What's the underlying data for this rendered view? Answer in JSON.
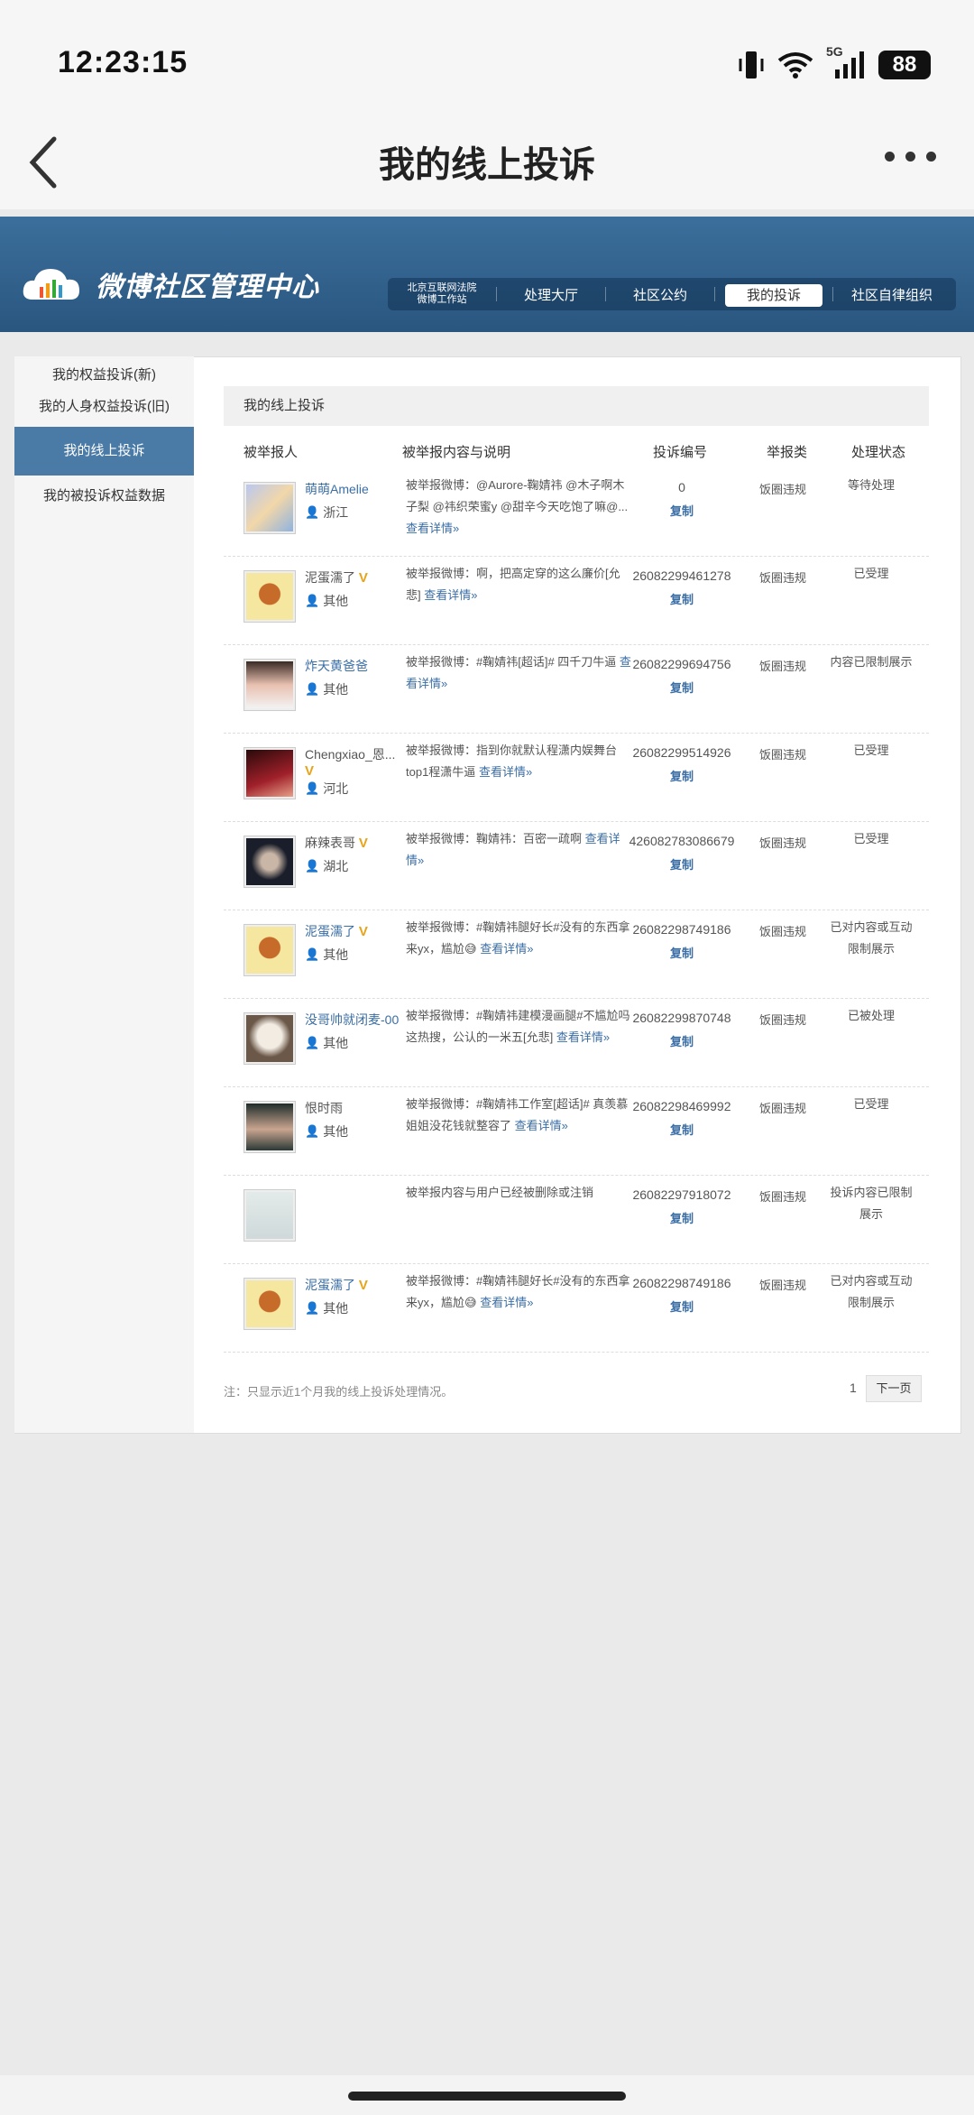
{
  "status_bar": {
    "time": "12:23:15",
    "network": "5G",
    "battery": "88"
  },
  "header": {
    "title": "我的线上投诉"
  },
  "banner": {
    "logo_text": "微博社区管理中心",
    "nav": [
      {
        "label": "北京互联网法院\n微博工作站"
      },
      {
        "label": "处理大厅"
      },
      {
        "label": "社区公约"
      },
      {
        "label": "我的投诉"
      },
      {
        "label": "社区自律组织"
      }
    ]
  },
  "sidebar": {
    "items": [
      {
        "label": "我的权益投诉(新)"
      },
      {
        "label": "我的人身权益投诉(旧)"
      },
      {
        "label": "我的线上投诉"
      },
      {
        "label": "我的被投诉权益数据"
      }
    ]
  },
  "panel": {
    "title": "我的线上投诉",
    "columns": [
      "被举报人",
      "被举报内容与说明",
      "投诉编号",
      "举报类",
      "处理状态"
    ],
    "copy_label": "复制",
    "rows": [
      {
        "name": "萌萌Amelie",
        "location": "浙江",
        "content": "被举报微博：@Aurore-鞠婧祎 @木子啊木子梨 @祎织荣蜜y @甜辛今天吃饱了嘛@...",
        "more": "查看详情»",
        "id": "0",
        "category": "饭圈违规",
        "status": "等待处理"
      },
      {
        "name": "泥蛋濡了",
        "location": "其他",
        "content": "被举报微博：啊，把高定穿的这么廉价[允悲]",
        "more": "查看详情»",
        "id": "26082299461278",
        "category": "饭圈违规",
        "status": "已受理"
      },
      {
        "name": "炸天黄爸爸",
        "location": "其他",
        "content": "被举报微博：#鞠婧祎[超话]# 四千刀牛逼",
        "more": "查看详情»",
        "id": "26082299694756",
        "category": "饭圈违规",
        "status": "内容已限制展示"
      },
      {
        "name": "Chengxiao_恩...",
        "location": "河北",
        "content": "被举报微博：指到你就默认程潇内娱舞台top1程潇牛逼",
        "more": "查看详情»",
        "id": "26082299514926",
        "category": "饭圈违规",
        "status": "已受理"
      },
      {
        "name": "麻辣表哥",
        "location": "湖北",
        "content": "被举报微博：鞠婧祎：百密一疏啊",
        "more": "查看详情»",
        "id": "426082783086679",
        "category": "饭圈违规",
        "status": "已受理"
      },
      {
        "name": "泥蛋濡了",
        "location": "其他",
        "content": "被举报微博：#鞠婧祎腿好长#没有的东西拿来yx，尴尬😅",
        "more": "查看详情»",
        "id": "26082298749186",
        "category": "饭圈违规",
        "status": "已对内容或互动限制展示"
      },
      {
        "name": "没哥帅就闭麦-00",
        "location": "其他",
        "content": "被举报微博：#鞠婧祎建模漫画腿#不尴尬吗这热搜，公认的一米五[允悲]",
        "more": "查看详情»",
        "id": "26082299870748",
        "category": "饭圈违规",
        "status": "已被处理"
      },
      {
        "name": "恨时雨",
        "location": "其他",
        "content": "被举报微博：#鞠婧祎工作室[超话]# 真羡慕姐姐没花钱就整容了",
        "more": "查看详情»",
        "id": "26082298469992",
        "category": "饭圈违规",
        "status": "已受理"
      },
      {
        "name": "",
        "location": "",
        "content": "被举报内容与用户已经被删除或注销",
        "more": "",
        "id": "26082297918072",
        "category": "饭圈违规",
        "status": "投诉内容已限制展示"
      },
      {
        "name": "泥蛋濡了",
        "location": "其他",
        "content": "被举报微博：#鞠婧祎腿好长#没有的东西拿来yx，尴尬😅",
        "more": "查看详情»",
        "id": "26082298749186",
        "category": "饭圈违规",
        "status": "已对内容或互动限制展示"
      }
    ],
    "note": "注：只显示近1个月我的线上投诉处理情况。",
    "page": "1",
    "next": "下一页"
  }
}
